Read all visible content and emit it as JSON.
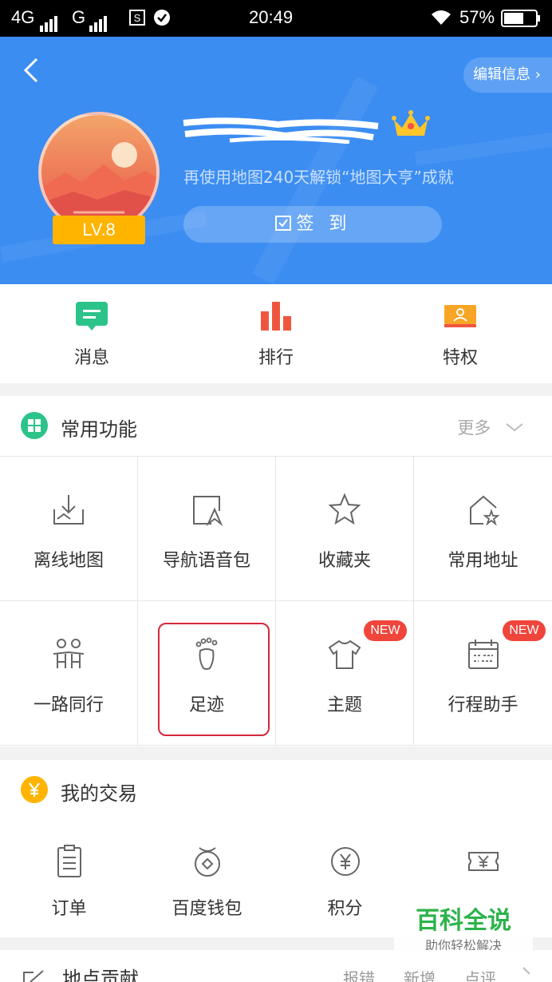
{
  "status_bar": {
    "network_1": "4G",
    "network_2": "G",
    "time": "20:49",
    "battery_percent": "57%"
  },
  "header": {
    "back_icon": "chevron-left-icon",
    "edit_label": "编辑信息",
    "level_badge": "LV.8",
    "unlock_text": "再使用地图240天解锁“地图大亨”成就",
    "checkin_label": "签 到"
  },
  "top_nav": [
    {
      "label": "消息",
      "icon": "message-icon",
      "color": "#2cc38b"
    },
    {
      "label": "排行",
      "icon": "ranking-icon",
      "color": "#f0563f"
    },
    {
      "label": "特权",
      "icon": "privilege-icon",
      "color": "#f7a524"
    }
  ],
  "common_functions": {
    "title": "常用功能",
    "more_label": "更多",
    "items": [
      {
        "label": "离线地图",
        "icon": "offline-map-icon"
      },
      {
        "label": "导航语音包",
        "icon": "voice-pack-icon"
      },
      {
        "label": "收藏夹",
        "icon": "star-icon"
      },
      {
        "label": "常用地址",
        "icon": "home-star-icon"
      },
      {
        "label": "一路同行",
        "icon": "companions-icon"
      },
      {
        "label": "足迹",
        "icon": "footprint-icon"
      },
      {
        "label": "主题",
        "icon": "tshirt-icon",
        "badge": "NEW"
      },
      {
        "label": "行程助手",
        "icon": "calendar-icon",
        "badge": "NEW"
      }
    ]
  },
  "transactions": {
    "title": "我的交易",
    "items": [
      {
        "label": "订单",
        "icon": "order-icon"
      },
      {
        "label": "百度钱包",
        "icon": "wallet-icon"
      },
      {
        "label": "积分",
        "icon": "points-icon"
      },
      {
        "label": "",
        "icon": "coupon-icon"
      }
    ]
  },
  "watermark": {
    "title": "百科全说",
    "subtitle": "助你轻松解决"
  },
  "bottom_section": {
    "title": "地点贡献",
    "actions": [
      "报错",
      "新增",
      "点评"
    ]
  },
  "colors": {
    "header_blue": "#3b8df2",
    "badge_orange": "#ffb400",
    "new_red": "#f0453b",
    "highlight_red": "#d6263b"
  }
}
